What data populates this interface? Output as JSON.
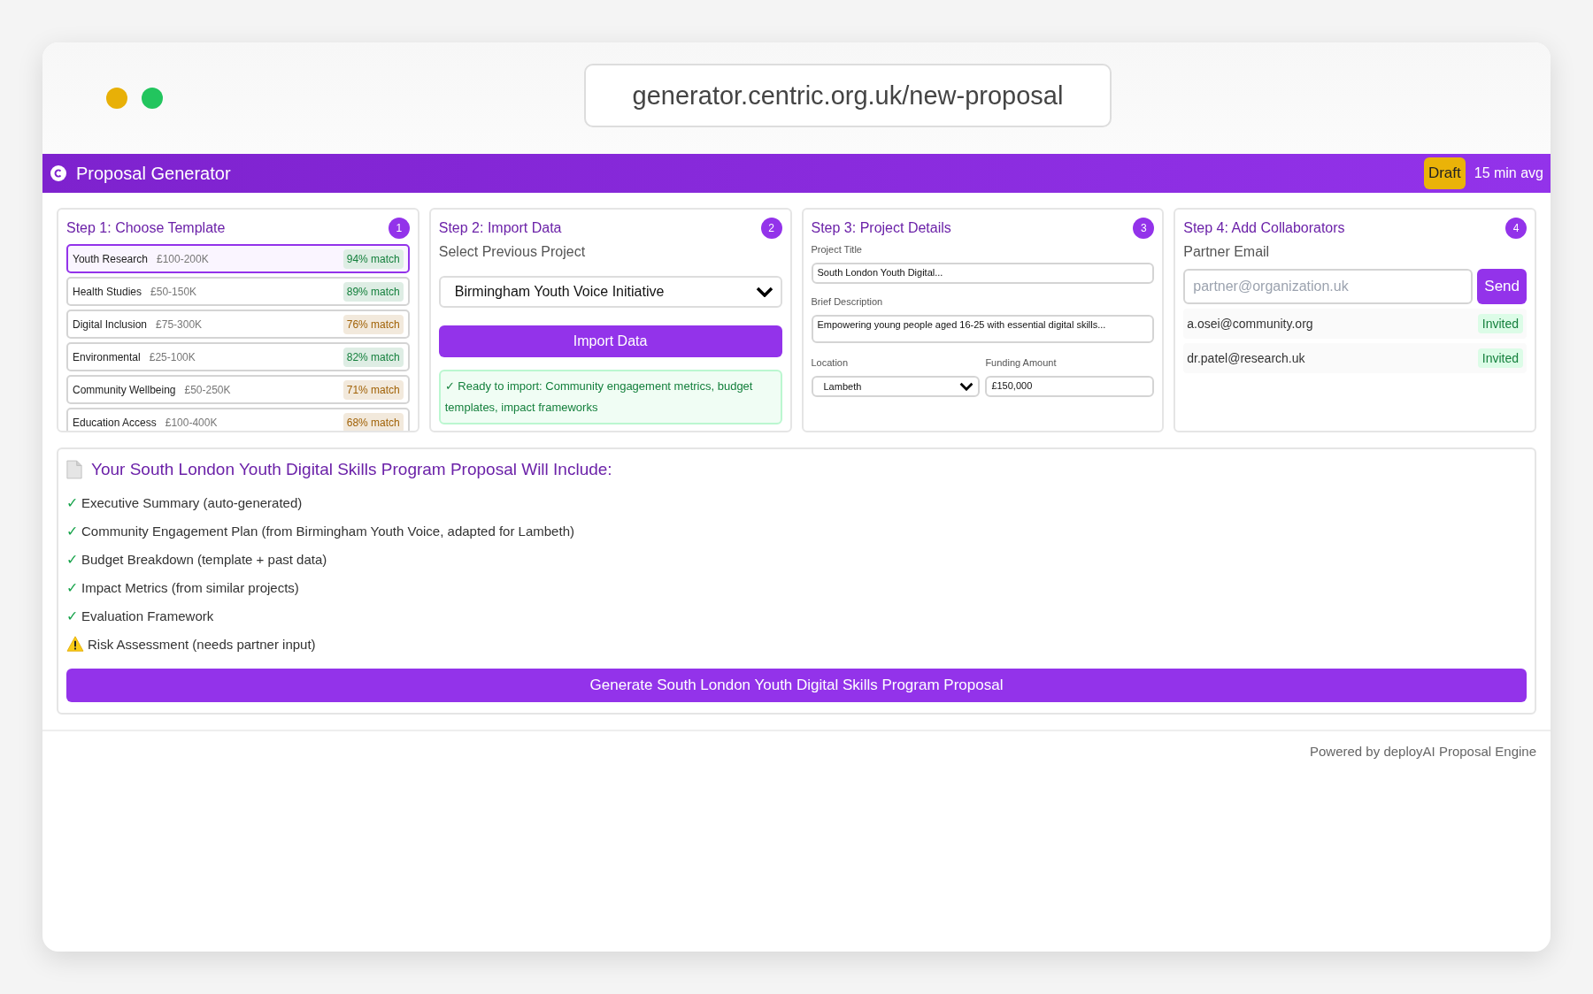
{
  "browser": {
    "url": "generator.centric.org.uk/new-proposal"
  },
  "header": {
    "title": "Proposal Generator",
    "badge": "Draft",
    "meta": "15 min avg"
  },
  "steps": [
    {
      "title": "Step 1: Choose Template",
      "number": "1"
    },
    {
      "title": "Step 2: Import Data",
      "number": "2"
    },
    {
      "title": "Step 3: Project Details",
      "number": "3"
    },
    {
      "title": "Step 4: Add Collaborators",
      "number": "4"
    }
  ],
  "templates": [
    {
      "name": "Youth Research",
      "range": "£100-200K",
      "match": "94% match",
      "color": "#15803d",
      "selected": true
    },
    {
      "name": "Health Studies",
      "range": "£50-150K",
      "match": "89% match",
      "color": "#15803d",
      "selected": false
    },
    {
      "name": "Digital Inclusion",
      "range": "£75-300K",
      "match": "76% match",
      "color": "#a16207",
      "selected": false
    },
    {
      "name": "Environmental",
      "range": "£25-100K",
      "match": "82% match",
      "color": "#15803d",
      "selected": false
    },
    {
      "name": "Community Wellbeing",
      "range": "£50-250K",
      "match": "71% match",
      "color": "#a16207",
      "selected": false
    },
    {
      "name": "Education Access",
      "range": "£100-400K",
      "match": "68% match",
      "color": "#a16207",
      "selected": false
    }
  ],
  "import": {
    "label": "Select Previous Project",
    "value": "Birmingham Youth Voice Initiative",
    "button": "Import Data",
    "notice": "✓ Ready to import: Community engagement metrics, budget templates, impact frameworks"
  },
  "details": {
    "title_label": "Project Title",
    "title_value": "South London Youth Digital...",
    "description_label": "Brief Description",
    "description_value": "Empowering young people aged 16-25 with essential digital skills...",
    "location_label": "Location",
    "location_value": "Lambeth",
    "funding_label": "Funding Amount",
    "funding_value": "£150,000"
  },
  "collaborators": {
    "label": "Partner Email",
    "placeholder": "partner@organization.uk",
    "button": "Send",
    "invites": [
      {
        "email": "a.osei@community.org",
        "status": "Invited"
      },
      {
        "email": "dr.patel@research.uk",
        "status": "Invited"
      }
    ]
  },
  "summary": {
    "title": "Your South London Youth Digital Skills Program Proposal Will Include:",
    "items": [
      {
        "kind": "check",
        "mark": "✓",
        "text": "Executive Summary (auto-generated)"
      },
      {
        "kind": "check",
        "mark": "✓",
        "text": "Community Engagement Plan (from Birmingham Youth Voice, adapted for Lambeth)"
      },
      {
        "kind": "check",
        "mark": "✓",
        "text": "Budget Breakdown (template + past data)"
      },
      {
        "kind": "check",
        "mark": "✓",
        "text": "Impact Metrics (from similar projects)"
      },
      {
        "kind": "check",
        "mark": "✓",
        "text": "Evaluation Framework"
      },
      {
        "kind": "warning",
        "text": "Risk Assessment (needs partner input)"
      }
    ],
    "button": "Generate South London Youth Digital Skills Program Proposal"
  },
  "footer": "Powered by deployAI Proposal Engine"
}
